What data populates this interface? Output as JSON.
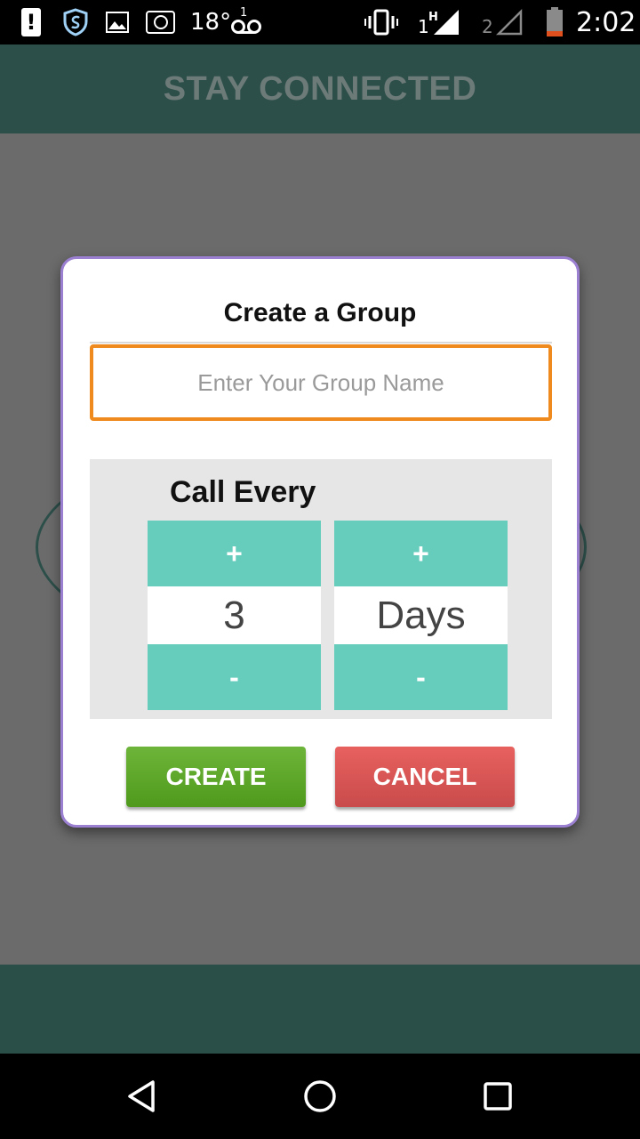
{
  "status_bar": {
    "temperature": "18°",
    "voicemail_count": "1",
    "signal1_label": "1",
    "signal1_network": "H",
    "signal2_label": "2",
    "time": "2:02",
    "icons": [
      "alert-icon",
      "shield-icon",
      "image-icon",
      "camera-icon",
      "voicemail-icon",
      "vibrate-icon",
      "signal-icon",
      "signal-icon",
      "battery-icon"
    ]
  },
  "app_bar": {
    "title": "STAY CONNECTED"
  },
  "dialog": {
    "title": "Create a Group",
    "group_name_placeholder": "Enter Your Group Name",
    "group_name_value": "",
    "call_every_label": "Call Every",
    "number_picker": {
      "plus_label": "+",
      "value": "3",
      "minus_label": "-"
    },
    "unit_picker": {
      "plus_label": "+",
      "value": "Days",
      "minus_label": "-"
    },
    "create_label": "CREATE",
    "cancel_label": "CANCEL"
  },
  "colors": {
    "app_bar": "#2d4f4a",
    "overlay": "#6b6b6b",
    "dialog_border": "#9b7fd1",
    "input_border": "#ef8a1f",
    "picker_button": "#66ccbc",
    "create_button": "#5ea62a",
    "cancel_button": "#dc5856"
  },
  "nav_bar": {
    "icons": [
      "back-icon",
      "home-icon",
      "recent-apps-icon"
    ]
  }
}
